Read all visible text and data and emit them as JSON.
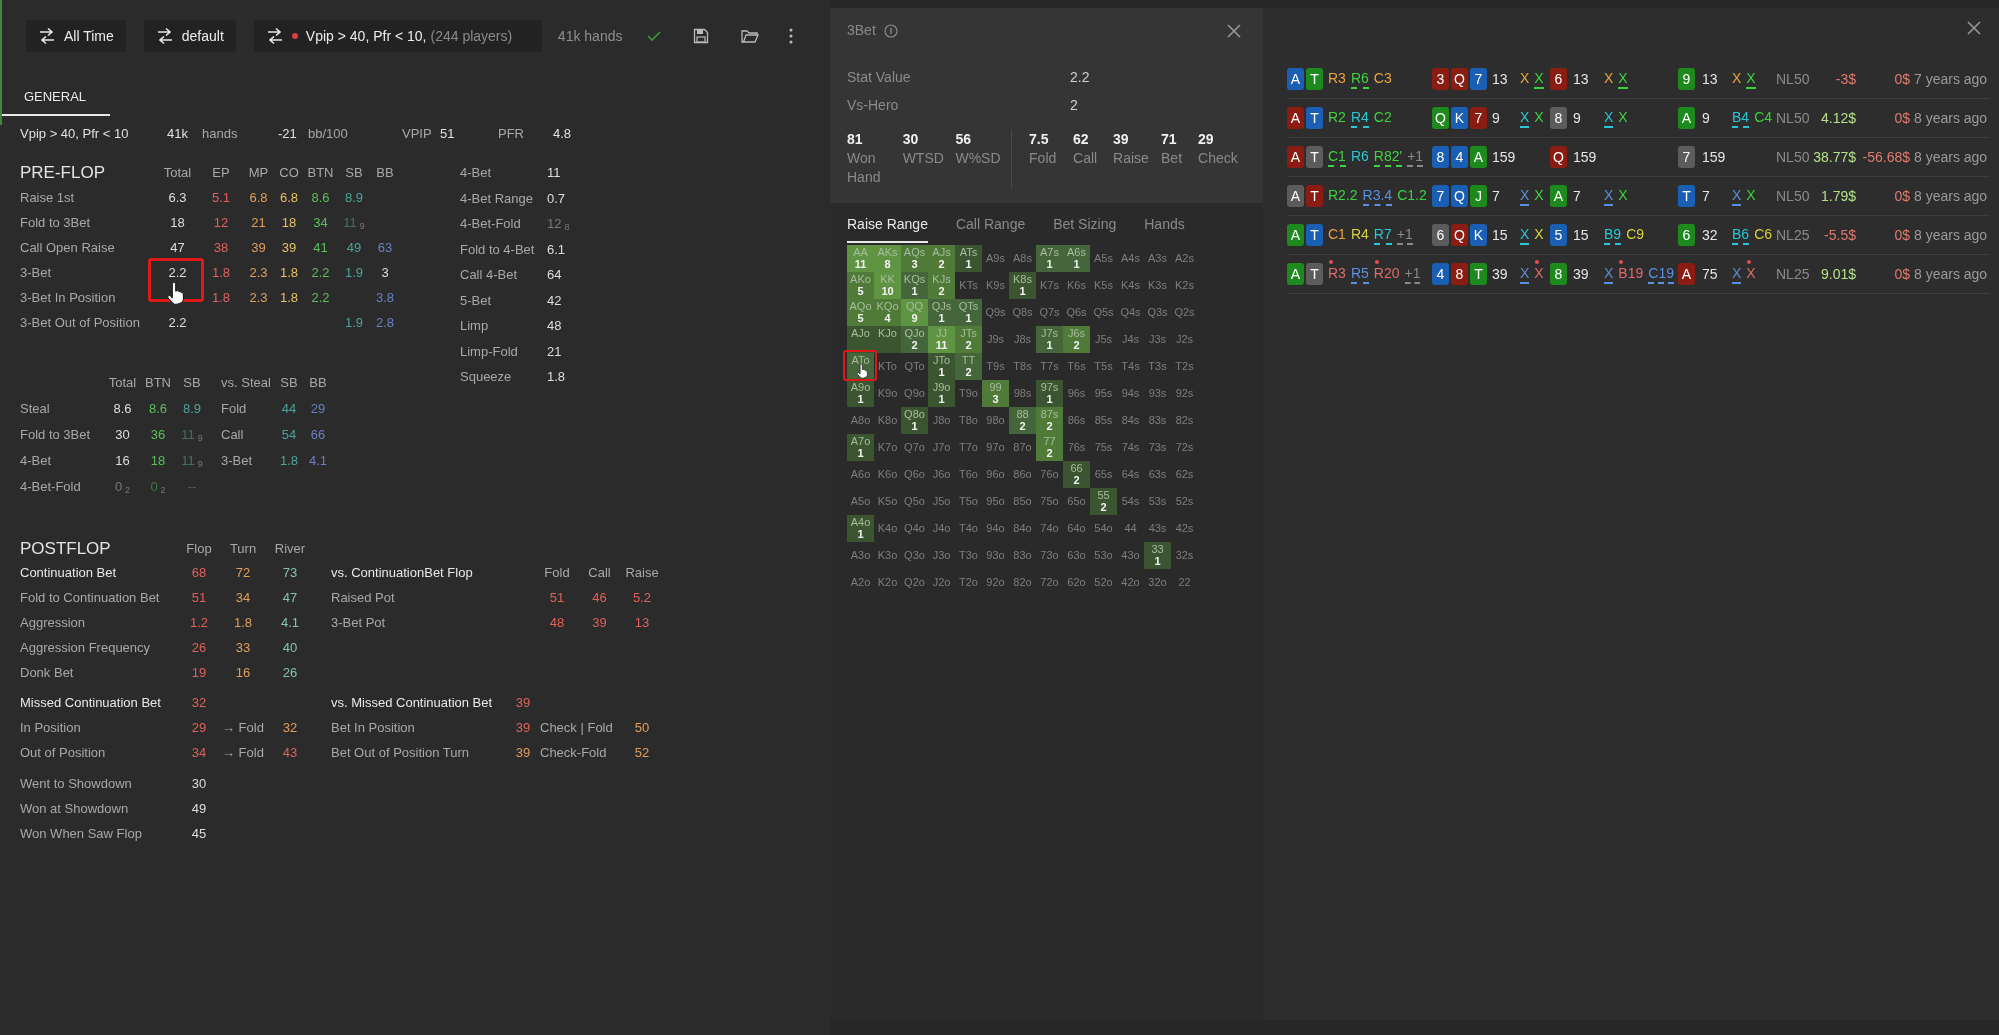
{
  "toolbar": {
    "buttons": [
      {
        "label": "All Time"
      },
      {
        "label": "default"
      }
    ],
    "filter": {
      "name": "Vpip > 40, Pfr < 10,",
      "players": "(244 players)"
    },
    "hands": "41k hands"
  },
  "tabs": [
    {
      "label": "GENERAL",
      "selected": true
    }
  ],
  "summary": {
    "name": "Vpip > 40, Pfr < 10",
    "hands": "41k",
    "hands_unit": "hands",
    "winrate": "-21",
    "winrate_unit": "bb/100",
    "vpip_label": "VPIP",
    "vpip": "51",
    "pfr_label": "PFR",
    "pfr": "4.8"
  },
  "preflop": {
    "title": "PRE-FLOP",
    "columns": [
      "Total",
      "EP",
      "MP",
      "CO",
      "BTN",
      "SB",
      "BB"
    ],
    "rows": [
      {
        "label": "Raise 1st",
        "values": {
          "total": {
            "v": "6.3",
            "color": "#dedede"
          },
          "ep": {
            "v": "5.1",
            "color": "#e0605c"
          },
          "mp": {
            "v": "6.8",
            "color": "#e09e5a"
          },
          "co": {
            "v": "6.8",
            "color": "#e6c265"
          },
          "btn": {
            "v": "8.6",
            "color": "#5cbf5c"
          },
          "sb": {
            "v": "8.9",
            "color": "#4aa39b"
          }
        }
      },
      {
        "label": "Fold to 3Bet",
        "values": {
          "total": {
            "v": "18",
            "color": "#dedede"
          },
          "ep": {
            "v": "12",
            "color": "#e0605c"
          },
          "mp": {
            "v": "21",
            "color": "#e09e5a"
          },
          "co": {
            "v": "18",
            "color": "#e6c265"
          },
          "btn": {
            "v": "34",
            "color": "#5cbf5c"
          },
          "sb": {
            "v": "11$_{9}$",
            "color": "#446e69"
          }
        }
      },
      {
        "label": "Call Open Raise",
        "values": {
          "total": {
            "v": "47",
            "color": "#dedede"
          },
          "ep": {
            "v": "38",
            "color": "#e0605c"
          },
          "mp": {
            "v": "39",
            "color": "#e09e5a"
          },
          "co": {
            "v": "39",
            "color": "#e6c265"
          },
          "btn": {
            "v": "41",
            "color": "#5cbf5c"
          },
          "sb": {
            "v": "49",
            "color": "#4aa39b"
          },
          "bb": {
            "v": "63",
            "color": "#6b7fc4"
          }
        }
      },
      {
        "label": "3-Bet",
        "values": {
          "total": {
            "v": "2.2",
            "color": "#dedede"
          },
          "ep": {
            "v": "1.8",
            "color": "#e0605c"
          },
          "mp": {
            "v": "2.3",
            "color": "#e09e5a"
          },
          "co": {
            "v": "1.8",
            "color": "#e6c265"
          },
          "btn": {
            "v": "2.2",
            "color": "#5cbf5c"
          },
          "sb": {
            "v": "1.9",
            "color": "#4aa39b"
          },
          "bb": {
            "v": "3",
            "color": "#dedede"
          }
        }
      },
      {
        "label": "3-Bet In Position",
        "values": {
          "ep": {
            "v": "1.8",
            "color": "#e0605c"
          },
          "mp": {
            "v": "2.3",
            "color": "#e09e5a"
          },
          "co": {
            "v": "1.8",
            "color": "#e6c265"
          },
          "btn": {
            "v": "2.2",
            "color": "#5cbf5c"
          },
          "bb": {
            "v": "3.8",
            "color": "#6b7fc4"
          }
        }
      },
      {
        "label": "3-Bet Out of Position",
        "values": {
          "total": {
            "v": "2.2",
            "color": "#dedede"
          },
          "sb": {
            "v": "1.9",
            "color": "#4aa39b"
          },
          "bb": {
            "v": "2.8",
            "color": "#6b7fc4"
          }
        }
      }
    ]
  },
  "preflop_side": [
    {
      "label": "4-Bet",
      "v": "11",
      "color": "#dedede"
    },
    {
      "label": "4-Bet Range",
      "v": "0.7",
      "color": "#dedede"
    },
    {
      "label": "4-Bet-Fold",
      "v": "12$_{8}$",
      "color": "#7a7a7a"
    },
    {
      "label": "Fold to 4-Bet",
      "v": "6.1",
      "color": "#dedede"
    },
    {
      "label": "Call 4-Bet",
      "v": "64",
      "color": "#dedede"
    },
    {
      "label": "5-Bet",
      "v": "42",
      "color": "#dedede"
    },
    {
      "label": "Limp",
      "v": "48",
      "color": "#dedede"
    },
    {
      "label": "Limp-Fold",
      "v": "21",
      "color": "#dedede"
    },
    {
      "label": "Squeeze",
      "v": "1.8",
      "color": "#dedede"
    }
  ],
  "steal": {
    "columns": [
      "Total",
      "BTN",
      "SB",
      "vs. Steal",
      "SB",
      "BB"
    ],
    "rows": [
      {
        "label": "Steal",
        "values": {
          "total": {
            "v": "8.6",
            "color": "#dedede"
          },
          "btn": {
            "v": "8.6",
            "color": "#5cbf5c"
          },
          "sb": {
            "v": "8.9",
            "color": "#4aa39b"
          },
          "vs_steal": {
            "v": "Fold",
            "color": "#a8a8a8"
          },
          "vs_sb": {
            "v": "44",
            "color": "#4aa39b"
          },
          "vs_bb": {
            "v": "29",
            "color": "#6b7fc4"
          }
        }
      },
      {
        "label": "Fold to 3Bet",
        "values": {
          "total": {
            "v": "30",
            "color": "#dedede"
          },
          "btn": {
            "v": "36",
            "color": "#5cbf5c"
          },
          "sb": {
            "v": "11$_{9}$",
            "color": "#446e69"
          },
          "vs_steal": {
            "v": "Call",
            "color": "#a8a8a8"
          },
          "vs_sb": {
            "v": "54",
            "color": "#4aa39b"
          },
          "vs_bb": {
            "v": "66",
            "color": "#6b7fc4"
          }
        }
      },
      {
        "label": "4-Bet",
        "values": {
          "total": {
            "v": "16",
            "color": "#dedede"
          },
          "btn": {
            "v": "18",
            "color": "#5cbf5c"
          },
          "sb": {
            "v": "11$_{9}$",
            "color": "#446e69"
          },
          "vs_steal": {
            "v": "3-Bet",
            "color": "#a8a8a8"
          },
          "vs_sb": {
            "v": "1.8",
            "color": "#4aa39b"
          },
          "vs_bb": {
            "v": "4.1",
            "color": "#6b7fc4"
          }
        }
      },
      {
        "label": "4-Bet-Fold",
        "values": {
          "total": {
            "v": "0$_{2}$",
            "color": "#7a7a7a"
          },
          "btn": {
            "v": "0$_{2}$",
            "color": "#3e7a40"
          },
          "sb": {
            "v": "--",
            "color": "#446e69"
          }
        }
      }
    ]
  },
  "postflop": {
    "title": "POSTFLOP",
    "columns": [
      "Flop",
      "Turn",
      "River"
    ],
    "rows": [
      {
        "label": "Continuation Bet",
        "emphasized": true,
        "values": [
          {
            "v": "68",
            "color": "#e0605c"
          },
          {
            "v": "72",
            "color": "#e09e5a"
          },
          {
            "v": "73",
            "color": "#86c2b4"
          }
        ]
      },
      {
        "label": "Fold to Continuation Bet",
        "emphasized": false,
        "values": [
          {
            "v": "51",
            "color": "#e0605c"
          },
          {
            "v": "34",
            "color": "#e09e5a"
          },
          {
            "v": "47",
            "color": "#86c2b4"
          }
        ]
      },
      {
        "label": "Aggression",
        "emphasized": false,
        "values": [
          {
            "v": "1.2",
            "color": "#e0605c"
          },
          {
            "v": "1.8",
            "color": "#e09e5a"
          },
          {
            "v": "4.1",
            "color": "#86c2b4"
          }
        ]
      },
      {
        "label": "Aggression Frequency",
        "emphasized": false,
        "values": [
          {
            "v": "26",
            "color": "#e0605c"
          },
          {
            "v": "33",
            "color": "#e09e5a"
          },
          {
            "v": "40",
            "color": "#86c2b4"
          }
        ]
      },
      {
        "label": "Donk Bet",
        "emphasized": false,
        "values": [
          {
            "v": "19",
            "color": "#e0605c"
          },
          {
            "v": "16",
            "color": "#e09e5a"
          },
          {
            "v": "26",
            "color": "#86c2b4"
          }
        ]
      }
    ]
  },
  "missed": {
    "title": "Missed Continuation Bet",
    "value": {
      "v": "32",
      "color": "#e0605c"
    },
    "rows": [
      {
        "label": "In Position",
        "values": [
          {
            "v": "29",
            "color": "#e0605c"
          },
          {
            "v": "→ Fold",
            "color": "#a8a8a8"
          },
          {
            "v": "32",
            "color": "#e09e5a"
          }
        ]
      },
      {
        "label": "Out of Position",
        "values": [
          {
            "v": "34",
            "color": "#e0605c"
          },
          {
            "v": "→ Fold",
            "color": "#a8a8a8"
          },
          {
            "v": "43",
            "color": "#e0605c"
          }
        ]
      }
    ]
  },
  "showdown": [
    {
      "label": "Went to Showdown",
      "v": "30",
      "color": "#dedede"
    },
    {
      "label": "Won at Showdown",
      "v": "49",
      "color": "#dedede"
    },
    {
      "label": "Won When Saw Flop",
      "v": "45",
      "color": "#dedede"
    }
  ],
  "vs_cbet": {
    "title": "vs. ContinuationBet Flop",
    "columns": [
      "Fold",
      "Call",
      "Raise"
    ],
    "rows": [
      {
        "label": "Raised Pot",
        "values": [
          {
            "v": "51",
            "color": "#e0605c"
          },
          {
            "v": "46",
            "color": "#e0605c"
          },
          {
            "v": "5.2",
            "color": "#e0605c"
          }
        ]
      },
      {
        "label": "3-Bet Pot",
        "values": [
          {
            "v": "48",
            "color": "#e0605c"
          },
          {
            "v": "39",
            "color": "#e0605c"
          },
          {
            "v": "13",
            "color": "#e0605c"
          }
        ]
      }
    ]
  },
  "vs_missed": {
    "title": "vs. Missed Continuation Bet",
    "value": {
      "v": "39",
      "color": "#e0605c"
    },
    "rows": [
      {
        "label": "Bet In Position",
        "values": [
          {
            "v": "39",
            "color": "#e0605c"
          },
          {
            "v": "Check | Fold",
            "color": "#a8a8a8"
          },
          {
            "v": "50",
            "color": "#e09e5a"
          }
        ]
      },
      {
        "label": "Bet Out of Position Turn",
        "values": [
          {
            "v": "39",
            "color": "#e09e5a"
          },
          {
            "v": "Check-Fold",
            "color": "#a8a8a8"
          },
          {
            "v": "52",
            "color": "#e09e5a"
          }
        ]
      }
    ]
  },
  "popup": {
    "title": "3Bet",
    "stat_rows": [
      {
        "label": "Stat Value",
        "value": "2.2"
      },
      {
        "label": "Vs-Hero",
        "value": "2"
      }
    ],
    "stats_left": [
      {
        "value": "81",
        "label": "Won Hand"
      },
      {
        "value": "30",
        "label": "WTSD"
      },
      {
        "value": "56",
        "label": "W%SD"
      }
    ],
    "stats_right": [
      {
        "value": "7.5",
        "label": "Fold"
      },
      {
        "value": "62",
        "label": "Call"
      },
      {
        "value": "39",
        "label": "Raise"
      },
      {
        "value": "71",
        "label": "Bet"
      },
      {
        "value": "29",
        "label": "Check"
      }
    ],
    "tabs": [
      {
        "label": "Raise Range",
        "selected": true
      },
      {
        "label": "Call Range",
        "selected": false
      },
      {
        "label": "Bet Sizing",
        "selected": false
      },
      {
        "label": "Hands",
        "selected": false
      }
    ],
    "range_grid": [
      [
        {
          "hand": "AA",
          "count": "11",
          "color": "#5f9443"
        },
        {
          "hand": "AKs",
          "count": "8",
          "color": "#5f9443"
        },
        {
          "hand": "AQs",
          "count": "3",
          "color": "#4f7a38"
        },
        {
          "hand": "AJs",
          "count": "2",
          "color": "#4f7a38"
        },
        {
          "hand": "ATs",
          "count": "1",
          "color": "#3b5531"
        },
        {
          "hand": "A9s"
        },
        {
          "hand": "A8s"
        },
        {
          "hand": "A7s",
          "count": "1",
          "color": "#44663a"
        },
        {
          "hand": "A6s",
          "count": "1",
          "color": "#44663a"
        },
        {
          "hand": "A5s"
        },
        {
          "hand": "A4s"
        },
        {
          "hand": "A3s"
        },
        {
          "hand": "A2s"
        }
      ],
      [
        {
          "hand": "AKo",
          "count": "5",
          "color": "#4f7a38"
        },
        {
          "hand": "KK",
          "count": "10",
          "color": "#5f9443"
        },
        {
          "hand": "KQs",
          "count": "1",
          "color": "#44663a"
        },
        {
          "hand": "KJs",
          "count": "2",
          "color": "#4f7a38"
        },
        {
          "hand": "KTs"
        },
        {
          "hand": "K9s"
        },
        {
          "hand": "K8s",
          "count": "1",
          "color": "#3b5531"
        },
        {
          "hand": "K7s"
        },
        {
          "hand": "K6s"
        },
        {
          "hand": "K5s"
        },
        {
          "hand": "K4s"
        },
        {
          "hand": "K3s"
        },
        {
          "hand": "K2s"
        }
      ],
      [
        {
          "hand": "AQo",
          "count": "5",
          "color": "#4f7a38"
        },
        {
          "hand": "KQo",
          "count": "4",
          "color": "#4f7a38"
        },
        {
          "hand": "QQ",
          "count": "9",
          "color": "#5f9443"
        },
        {
          "hand": "QJs",
          "count": "1",
          "color": "#44663a"
        },
        {
          "hand": "QTs",
          "count": "1",
          "color": "#44663a"
        },
        {
          "hand": "Q9s"
        },
        {
          "hand": "Q8s"
        },
        {
          "hand": "Q7s"
        },
        {
          "hand": "Q6s"
        },
        {
          "hand": "Q5s"
        },
        {
          "hand": "Q4s"
        },
        {
          "hand": "Q3s"
        },
        {
          "hand": "Q2s"
        }
      ],
      [
        {
          "hand": "AJo",
          "color": "#3b5531"
        },
        {
          "hand": "KJo",
          "color": "#3b5531"
        },
        {
          "hand": "QJo",
          "count": "2",
          "color": "#44663a"
        },
        {
          "hand": "JJ",
          "count": "11",
          "color": "#5f9443"
        },
        {
          "hand": "JTs",
          "count": "2",
          "color": "#4f7a38"
        },
        {
          "hand": "J9s"
        },
        {
          "hand": "J8s"
        },
        {
          "hand": "J7s",
          "count": "1",
          "color": "#44663a"
        },
        {
          "hand": "J6s",
          "count": "2",
          "color": "#4f7a38"
        },
        {
          "hand": "J5s"
        },
        {
          "hand": "J4s"
        },
        {
          "hand": "J3s"
        },
        {
          "hand": "J2s"
        }
      ],
      [
        {
          "hand": "ATo",
          "color": "#44663a"
        },
        {
          "hand": "KTo"
        },
        {
          "hand": "QTo"
        },
        {
          "hand": "JTo",
          "count": "1",
          "color": "#3b5531"
        },
        {
          "hand": "TT",
          "count": "2",
          "color": "#44663a"
        },
        {
          "hand": "T9s"
        },
        {
          "hand": "T8s"
        },
        {
          "hand": "T7s"
        },
        {
          "hand": "T6s"
        },
        {
          "hand": "T5s"
        },
        {
          "hand": "T4s"
        },
        {
          "hand": "T3s"
        },
        {
          "hand": "T2s"
        }
      ],
      [
        {
          "hand": "A9o",
          "count": "1",
          "color": "#3b5531"
        },
        {
          "hand": "K9o"
        },
        {
          "hand": "Q9o"
        },
        {
          "hand": "J9o",
          "count": "1",
          "color": "#3b5531"
        },
        {
          "hand": "T9o"
        },
        {
          "hand": "99",
          "count": "3",
          "color": "#4f7a38"
        },
        {
          "hand": "98s"
        },
        {
          "hand": "97s",
          "count": "1",
          "color": "#3b5531"
        },
        {
          "hand": "96s"
        },
        {
          "hand": "95s"
        },
        {
          "hand": "94s"
        },
        {
          "hand": "93s"
        },
        {
          "hand": "92s"
        }
      ],
      [
        {
          "hand": "A8o"
        },
        {
          "hand": "K8o"
        },
        {
          "hand": "Q8o",
          "count": "1",
          "color": "#3b5531"
        },
        {
          "hand": "J8o"
        },
        {
          "hand": "T8o"
        },
        {
          "hand": "98o"
        },
        {
          "hand": "88",
          "count": "2",
          "color": "#44663a"
        },
        {
          "hand": "87s",
          "count": "2",
          "color": "#4f7a38"
        },
        {
          "hand": "86s"
        },
        {
          "hand": "85s"
        },
        {
          "hand": "84s"
        },
        {
          "hand": "83s"
        },
        {
          "hand": "82s"
        }
      ],
      [
        {
          "hand": "A7o",
          "count": "1",
          "color": "#3b5531"
        },
        {
          "hand": "K7o"
        },
        {
          "hand": "Q7o"
        },
        {
          "hand": "J7o"
        },
        {
          "hand": "T7o"
        },
        {
          "hand": "97o"
        },
        {
          "hand": "87o"
        },
        {
          "hand": "77",
          "count": "2",
          "color": "#4f7a38"
        },
        {
          "hand": "76s"
        },
        {
          "hand": "75s"
        },
        {
          "hand": "74s"
        },
        {
          "hand": "73s"
        },
        {
          "hand": "72s"
        }
      ],
      [
        {
          "hand": "A6o"
        },
        {
          "hand": "K6o"
        },
        {
          "hand": "Q6o"
        },
        {
          "hand": "J6o"
        },
        {
          "hand": "T6o"
        },
        {
          "hand": "96o"
        },
        {
          "hand": "86o"
        },
        {
          "hand": "76o"
        },
        {
          "hand": "66",
          "count": "2",
          "color": "#3b5531"
        },
        {
          "hand": "65s"
        },
        {
          "hand": "64s"
        },
        {
          "hand": "63s"
        },
        {
          "hand": "62s"
        }
      ],
      [
        {
          "hand": "A5o"
        },
        {
          "hand": "K5o"
        },
        {
          "hand": "Q5o"
        },
        {
          "hand": "J5o"
        },
        {
          "hand": "T5o"
        },
        {
          "hand": "95o"
        },
        {
          "hand": "85o"
        },
        {
          "hand": "75o"
        },
        {
          "hand": "65o"
        },
        {
          "hand": "55",
          "count": "2",
          "color": "#3b5531"
        },
        {
          "hand": "54s"
        },
        {
          "hand": "53s"
        },
        {
          "hand": "52s"
        }
      ],
      [
        {
          "hand": "A4o",
          "count": "1",
          "color": "#3b5531"
        },
        {
          "hand": "K4o"
        },
        {
          "hand": "Q4o"
        },
        {
          "hand": "J4o"
        },
        {
          "hand": "T4o"
        },
        {
          "hand": "94o"
        },
        {
          "hand": "84o"
        },
        {
          "hand": "74o"
        },
        {
          "hand": "64o"
        },
        {
          "hand": "54o"
        },
        {
          "hand": "44"
        },
        {
          "hand": "43s"
        },
        {
          "hand": "42s"
        }
      ],
      [
        {
          "hand": "A3o"
        },
        {
          "hand": "K3o"
        },
        {
          "hand": "Q3o"
        },
        {
          "hand": "J3o"
        },
        {
          "hand": "T3o"
        },
        {
          "hand": "93o"
        },
        {
          "hand": "83o"
        },
        {
          "hand": "73o"
        },
        {
          "hand": "63o"
        },
        {
          "hand": "53o"
        },
        {
          "hand": "43o"
        },
        {
          "hand": "33",
          "count": "1",
          "color": "#3b5531"
        },
        {
          "hand": "32s"
        }
      ],
      [
        {
          "hand": "A2o"
        },
        {
          "hand": "K2o"
        },
        {
          "hand": "Q2o"
        },
        {
          "hand": "J2o"
        },
        {
          "hand": "T2o"
        },
        {
          "hand": "92o"
        },
        {
          "hand": "82o"
        },
        {
          "hand": "72o"
        },
        {
          "hand": "62o"
        },
        {
          "hand": "52o"
        },
        {
          "hand": "42o"
        },
        {
          "hand": "32o"
        },
        {
          "hand": "22"
        }
      ]
    ]
  },
  "hands": [
    {
      "hole": [
        {
          "rank": "A",
          "color": "#1a5fb4"
        },
        {
          "rank": "T",
          "color": "#1e8a1e"
        }
      ],
      "preflop": [
        {
          "text": "R3",
          "color": "#e8a33c",
          "underlined": false,
          "dot": false
        },
        {
          "text": "R6",
          "color": "#3fd23f",
          "underlined": true,
          "dot": false
        },
        {
          "text": "C3",
          "color": "#e8a33c",
          "underlined": false,
          "dot": false
        }
      ],
      "flop": {
        "cards": [
          {
            "rank": "3",
            "color": "#8a1c12"
          },
          {
            "rank": "Q",
            "color": "#8a1c12"
          },
          {
            "rank": "7",
            "color": "#1a5fb4"
          }
        ],
        "pot": "13",
        "actions": [
          {
            "text": "X",
            "color": "#e8a33c",
            "underlined": false,
            "dot": false
          },
          {
            "text": "X",
            "color": "#3fd23f",
            "underlined": true,
            "dot": false
          }
        ]
      },
      "turn": {
        "cards": [
          {
            "rank": "6",
            "color": "#8a1c12"
          }
        ],
        "pot": "13",
        "actions": [
          {
            "text": "X",
            "color": "#e8a33c",
            "underlined": false,
            "dot": false
          },
          {
            "text": "X",
            "color": "#3fd23f",
            "underlined": true,
            "dot": false
          }
        ]
      },
      "river": {
        "cards": [
          {
            "rank": "9",
            "color": "#1e8a1e"
          }
        ],
        "pot": "13",
        "actions": [
          {
            "text": "X",
            "color": "#e8a33c",
            "underlined": false,
            "dot": false
          },
          {
            "text": "X",
            "color": "#3fd23f",
            "underlined": true,
            "dot": false
          }
        ]
      },
      "stake": "NL50",
      "won": {
        "text": "-3$",
        "color": "#e07a6e"
      },
      "won_vs": {
        "text": "0$",
        "color": "#e07a6e"
      },
      "time": "7 years ago"
    },
    {
      "hole": [
        {
          "rank": "A",
          "color": "#8a1c12"
        },
        {
          "rank": "T",
          "color": "#1a5fb4"
        }
      ],
      "preflop": [
        {
          "text": "R2",
          "color": "#3fd23f",
          "underlined": false,
          "dot": false
        },
        {
          "text": "R4",
          "color": "#27c7d6",
          "underlined": true,
          "dot": false
        },
        {
          "text": "C2",
          "color": "#3fd23f",
          "underlined": false,
          "dot": false
        }
      ],
      "flop": {
        "cards": [
          {
            "rank": "Q",
            "color": "#1e8a1e"
          },
          {
            "rank": "K",
            "color": "#1a5fb4"
          },
          {
            "rank": "7",
            "color": "#8a1c12"
          }
        ],
        "pot": "9",
        "actions": [
          {
            "text": "X",
            "color": "#27c7d6",
            "underlined": true,
            "dot": false
          },
          {
            "text": "X",
            "color": "#3fd23f",
            "underlined": false,
            "dot": false
          }
        ]
      },
      "turn": {
        "cards": [
          {
            "rank": "8",
            "color": "#5c5c5c"
          }
        ],
        "pot": "9",
        "actions": [
          {
            "text": "X",
            "color": "#27c7d6",
            "underlined": true,
            "dot": false
          },
          {
            "text": "X",
            "color": "#3fd23f",
            "underlined": false,
            "dot": false
          }
        ]
      },
      "river": {
        "cards": [
          {
            "rank": "A",
            "color": "#1e8a1e"
          }
        ],
        "pot": "9",
        "actions": [
          {
            "text": "B4",
            "color": "#27c7d6",
            "underlined": true,
            "dot": false
          },
          {
            "text": "C4",
            "color": "#3fd23f",
            "underlined": false,
            "dot": false
          }
        ]
      },
      "stake": "NL50",
      "won": {
        "text": "4.12$",
        "color": "#b5e08a"
      },
      "won_vs": {
        "text": "0$",
        "color": "#e07a6e"
      },
      "time": "8 years ago"
    },
    {
      "hole": [
        {
          "rank": "A",
          "color": "#8a1c12"
        },
        {
          "rank": "T",
          "color": "#5c5c5c"
        }
      ],
      "preflop": [
        {
          "text": "C1",
          "color": "#3fd23f",
          "underlined": true,
          "dot": false
        },
        {
          "text": "R6",
          "color": "#27c7d6",
          "underlined": false,
          "dot": false
        },
        {
          "text": "R82'",
          "color": "#3fd23f",
          "underlined": true,
          "dot": false
        },
        {
          "text": "+1",
          "color": "#8a8a8a",
          "underlined": true,
          "dot": false
        }
      ],
      "flop": {
        "cards": [
          {
            "rank": "8",
            "color": "#1a5fb4"
          },
          {
            "rank": "4",
            "color": "#1a5fb4"
          },
          {
            "rank": "A",
            "color": "#1e8a1e"
          }
        ],
        "pot": "159"
      },
      "turn": {
        "cards": [
          {
            "rank": "Q",
            "color": "#8a1c12"
          }
        ],
        "pot": "159"
      },
      "river": {
        "cards": [
          {
            "rank": "7",
            "color": "#5c5c5c"
          }
        ],
        "pot": "159"
      },
      "stake": "NL50",
      "won": {
        "text": "38.77$",
        "color": "#b5e08a"
      },
      "won_vs": {
        "text": "-56.68$",
        "color": "#e07a6e"
      },
      "time": "8 years ago"
    },
    {
      "hole": [
        {
          "rank": "A",
          "color": "#5c5c5c"
        },
        {
          "rank": "T",
          "color": "#8a1c12"
        }
      ],
      "preflop": [
        {
          "text": "R2.2",
          "color": "#3fd23f",
          "underlined": false,
          "dot": false
        },
        {
          "text": "R3.4",
          "color": "#5b8fe0",
          "underlined": true,
          "dot": false
        },
        {
          "text": "C1.2",
          "color": "#3fd23f",
          "underlined": false,
          "dot": false
        }
      ],
      "flop": {
        "cards": [
          {
            "rank": "7",
            "color": "#1a5fb4"
          },
          {
            "rank": "Q",
            "color": "#1a5fb4"
          },
          {
            "rank": "J",
            "color": "#1e8a1e"
          }
        ],
        "pot": "7",
        "actions": [
          {
            "text": "X",
            "color": "#5b8fe0",
            "underlined": true,
            "dot": false
          },
          {
            "text": "X",
            "color": "#3fd23f",
            "underlined": false,
            "dot": false
          }
        ]
      },
      "turn": {
        "cards": [
          {
            "rank": "A",
            "color": "#1e8a1e"
          }
        ],
        "pot": "7",
        "actions": [
          {
            "text": "X",
            "color": "#5b8fe0",
            "underlined": true,
            "dot": false
          },
          {
            "text": "X",
            "color": "#3fd23f",
            "underlined": false,
            "dot": false
          }
        ]
      },
      "river": {
        "cards": [
          {
            "rank": "T",
            "color": "#1a5fb4"
          }
        ],
        "pot": "7",
        "actions": [
          {
            "text": "X",
            "color": "#5b8fe0",
            "underlined": true,
            "dot": false
          },
          {
            "text": "X",
            "color": "#3fd23f",
            "underlined": false,
            "dot": false
          }
        ]
      },
      "stake": "NL50",
      "won": {
        "text": "1.79$",
        "color": "#b5e08a"
      },
      "won_vs": {
        "text": "0$",
        "color": "#e07a6e"
      },
      "time": "8 years ago"
    },
    {
      "hole": [
        {
          "rank": "A",
          "color": "#1e8a1e"
        },
        {
          "rank": "T",
          "color": "#1a5fb4"
        }
      ],
      "preflop": [
        {
          "text": "C1",
          "color": "#e8a33c",
          "underlined": false,
          "dot": false
        },
        {
          "text": "R4",
          "color": "#d8d23a",
          "underlined": false,
          "dot": false
        },
        {
          "text": "R7",
          "color": "#27c7d6",
          "underlined": true,
          "dot": false
        },
        {
          "text": "+1",
          "color": "#8a8a8a",
          "underlined": true,
          "dot": false
        }
      ],
      "flop": {
        "cards": [
          {
            "rank": "6",
            "color": "#5c5c5c"
          },
          {
            "rank": "Q",
            "color": "#8a1c12"
          },
          {
            "rank": "K",
            "color": "#1a5fb4"
          }
        ],
        "pot": "15",
        "actions": [
          {
            "text": "X",
            "color": "#27c7d6",
            "underlined": true,
            "dot": false
          },
          {
            "text": "X",
            "color": "#d8d23a",
            "underlined": false,
            "dot": false
          }
        ]
      },
      "turn": {
        "cards": [
          {
            "rank": "5",
            "color": "#1a5fb4"
          }
        ],
        "pot": "15",
        "actions": [
          {
            "text": "B9",
            "color": "#27c7d6",
            "underlined": true,
            "dot": false
          },
          {
            "text": "C9",
            "color": "#d8d23a",
            "underlined": false,
            "dot": false
          }
        ]
      },
      "river": {
        "cards": [
          {
            "rank": "6",
            "color": "#1e8a1e"
          }
        ],
        "pot": "32",
        "actions": [
          {
            "text": "B6",
            "color": "#27c7d6",
            "underlined": true,
            "dot": false
          },
          {
            "text": "C6",
            "color": "#d8d23a",
            "underlined": false,
            "dot": false
          }
        ]
      },
      "stake": "NL25",
      "won": {
        "text": "-5.5$",
        "color": "#e07a6e"
      },
      "won_vs": {
        "text": "0$",
        "color": "#e07a6e"
      },
      "time": "8 years ago"
    },
    {
      "hole": [
        {
          "rank": "A",
          "color": "#1e8a1e"
        },
        {
          "rank": "T",
          "color": "#5c5c5c"
        }
      ],
      "preflop": [
        {
          "text": "R3",
          "color": "#e06a6a",
          "underlined": false,
          "dot": true
        },
        {
          "text": "R5",
          "color": "#5b8fe0",
          "underlined": true,
          "dot": false
        },
        {
          "text": "R20",
          "color": "#e06a6a",
          "underlined": false,
          "dot": true
        },
        {
          "text": "+1",
          "color": "#8a8a8a",
          "underlined": true,
          "dot": false
        }
      ],
      "flop": {
        "cards": [
          {
            "rank": "4",
            "color": "#1a5fb4"
          },
          {
            "rank": "8",
            "color": "#8a1c12"
          },
          {
            "rank": "T",
            "color": "#1e8a1e"
          }
        ],
        "pot": "39",
        "actions": [
          {
            "text": "X",
            "color": "#5b8fe0",
            "underlined": true,
            "dot": false
          },
          {
            "text": "X",
            "color": "#e06a6a",
            "underlined": false,
            "dot": true
          }
        ]
      },
      "turn": {
        "cards": [
          {
            "rank": "8",
            "color": "#1e8a1e"
          }
        ],
        "pot": "39",
        "actions": [
          {
            "text": "X",
            "color": "#5b8fe0",
            "underlined": true,
            "dot": false
          },
          {
            "text": "B19",
            "color": "#e06a6a",
            "underlined": false,
            "dot": true
          },
          {
            "text": "C19",
            "color": "#5b8fe0",
            "underlined": true,
            "dot": false
          }
        ]
      },
      "river": {
        "cards": [
          {
            "rank": "A",
            "color": "#8a1c12"
          }
        ],
        "pot": "75",
        "actions": [
          {
            "text": "X",
            "color": "#5b8fe0",
            "underlined": true,
            "dot": false
          },
          {
            "text": "X",
            "color": "#e06a6a",
            "underlined": false,
            "dot": true
          }
        ]
      },
      "stake": "NL25",
      "won": {
        "text": "9.01$",
        "color": "#b5e08a"
      },
      "won_vs": {
        "text": "0$",
        "color": "#e07a6e"
      },
      "time": "8 years ago"
    }
  ]
}
